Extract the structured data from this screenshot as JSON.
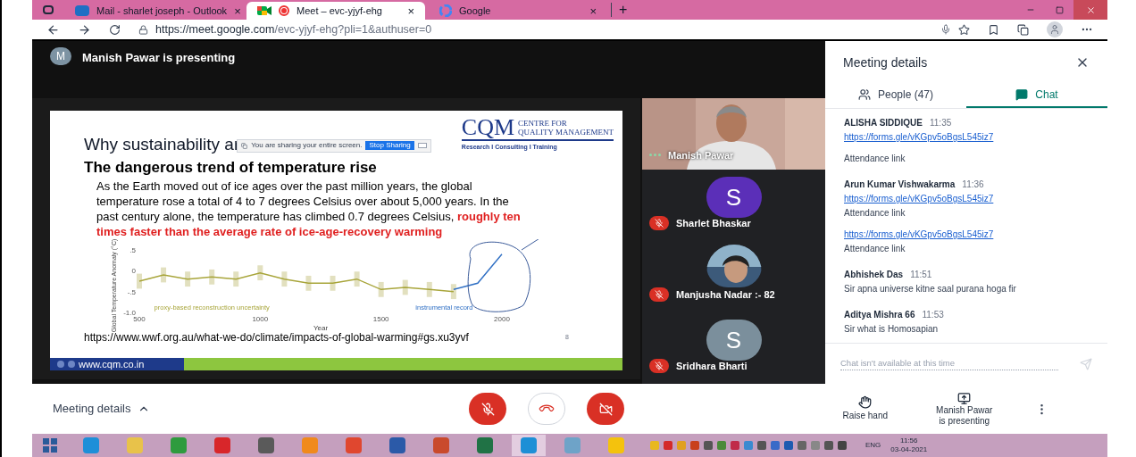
{
  "browser": {
    "tabs": [
      {
        "title": "Mail - sharlet joseph - Outlook",
        "kind": "mail",
        "selected": false,
        "recording": false,
        "close": "×"
      },
      {
        "title": "Meet – evc-yjyf-ehg",
        "kind": "meet",
        "selected": true,
        "recording": true,
        "close": "×"
      },
      {
        "title": "Google",
        "kind": "google",
        "selected": false,
        "recording": false,
        "close": "×"
      }
    ],
    "new_tab": "+",
    "url_host": "https://meet.google.com",
    "url_path": "/evc-yjyf-ehg?pli=1&authuser=0"
  },
  "presenter": {
    "initial": "M",
    "label": "Manish Pawar is presenting"
  },
  "slide": {
    "title": "Why sustainability ar",
    "sharing_notice": "You are sharing your entire screen.",
    "stop_button": "Stop Sharing",
    "logo": "CQM",
    "logo_line1": "CENTRE FOR",
    "logo_line2": "QUALITY MANAGEMENT",
    "logo_tagline": "Research I Consulting I Training",
    "heading": "The dangerous trend of temperature rise",
    "body": "As the Earth moved out of ice ages over the past million years, the global temperature rose a total of 4 to 7 degrees Celsius over about 5,000 years. In the past century alone, the temperature has climbed 0.7 degrees Celsius,",
    "highlight": "roughly ten times faster than the average rate of ice-age-recovery warming",
    "chart_data": {
      "type": "line",
      "xlabel": "Year",
      "ylabel": "Global Temperature Anomaly (°C)",
      "x": [
        500,
        600,
        700,
        800,
        900,
        1000,
        1100,
        1200,
        1300,
        1400,
        1500,
        1600,
        1700,
        1800,
        1900,
        2000
      ],
      "series": [
        {
          "name": "proxy-based reconstruction uncertainty",
          "color": "#a8a53a",
          "values": [
            -0.25,
            -0.1,
            -0.2,
            -0.15,
            -0.2,
            -0.05,
            -0.2,
            -0.3,
            -0.3,
            -0.2,
            -0.45,
            -0.4,
            -0.45,
            -0.5,
            null,
            null
          ],
          "errors": [
            0.18,
            0.18,
            0.18,
            0.18,
            0.18,
            0.18,
            0.18,
            0.18,
            0.18,
            0.18,
            0.18,
            0.18,
            0.18,
            0.18,
            null,
            null
          ]
        },
        {
          "name": "instrumental record",
          "color": "#2f6fc4",
          "values": [
            null,
            null,
            null,
            null,
            null,
            null,
            null,
            null,
            null,
            null,
            null,
            null,
            null,
            -0.45,
            -0.3,
            0.4
          ]
        }
      ],
      "xlim": [
        500,
        2000
      ],
      "ylim": [
        -1,
        0.5
      ],
      "xticks": [
        {
          "value": 500,
          "label": "500"
        },
        {
          "value": 1000,
          "label": "1000"
        },
        {
          "value": 1500,
          "label": "1500"
        },
        {
          "value": 2000,
          "label": "2000"
        }
      ],
      "yticks": [
        {
          "value": 0.5,
          "label": ".5"
        },
        {
          "value": 0,
          "label": "0"
        },
        {
          "value": -0.5,
          "label": "-.5"
        },
        {
          "value": -1,
          "label": "-1.0"
        }
      ]
    },
    "source": "https://www.wwf.org.au/what-we-do/climate/impacts-of-global-warming#gs.xu3yvf",
    "page": "8",
    "footer": "www.cqm.co.in"
  },
  "tiles": [
    {
      "kind": "video",
      "name": "Manish Pawar",
      "muted": false
    },
    {
      "kind": "letter",
      "name": "Sharlet Bhaskar",
      "initial": "S",
      "color": "#5b2fb8",
      "muted": true
    },
    {
      "name": "Manjusha Nadar :- 82",
      "muted": true
    },
    {
      "kind": "letter",
      "name": "Sridhara Bharti",
      "initial": "S",
      "color": "#7b8f9c",
      "muted": true
    }
  ],
  "panel": {
    "title": "Meeting details",
    "tabs": [
      {
        "label": "People (47)",
        "kind": "people",
        "selected": false
      },
      {
        "label": "Chat",
        "kind": "chat",
        "selected": true
      }
    ],
    "messages": [
      {
        "sender": "ALISHA SIDDIQUE",
        "time": "11:35",
        "items": [
          {
            "kind": "link",
            "text": "https://forms.gle/vKGpv5oBgsL545iz7"
          },
          {
            "kind": "text",
            "text": "Attendance link"
          }
        ]
      },
      {
        "sender": "Arun Kumar Vishwakarma",
        "time": "11:36",
        "items": [
          {
            "kind": "link",
            "text": "https://forms.gle/vKGpv5oBgsL545iz7"
          },
          {
            "kind": "text",
            "text": "Attendance link"
          },
          {
            "kind": "link",
            "text": "https://forms.gle/vKGpv5oBgsL545iz7"
          },
          {
            "kind": "text",
            "text": "Attendance link"
          }
        ]
      },
      {
        "sender": "Abhishek Das",
        "time": "11:51",
        "items": [
          {
            "kind": "text",
            "text": "Sir apna universe kitne saal purana hoga fir"
          }
        ]
      },
      {
        "sender": "Aditya Mishra 66",
        "time": "11:53",
        "items": [
          {
            "kind": "text",
            "text": "Sir what is Homosapian"
          }
        ]
      }
    ],
    "chat_placeholder": "Chat isn't available at this time",
    "chat_enabled": false
  },
  "bottom": {
    "details": "Meeting details",
    "mic_on": false,
    "camera_on": false,
    "raise_hand": "Raise hand",
    "presenting": [
      "Manish Pawar",
      "is presenting"
    ]
  },
  "taskbar": {
    "apps": [
      {
        "color": "#1e8fd8",
        "selected": false
      },
      {
        "color": "#e8c24a",
        "selected": false
      },
      {
        "color": "#2e9b3e",
        "selected": false
      },
      {
        "color": "#d8262a",
        "selected": false
      },
      {
        "color": "#5a5a5a",
        "selected": false
      },
      {
        "color": "#f08a1c",
        "selected": false
      },
      {
        "color": "#e0472f",
        "selected": false
      },
      {
        "color": "#2b5aa8",
        "selected": false
      },
      {
        "color": "#c94a2c",
        "selected": false
      },
      {
        "color": "#207245",
        "selected": false
      },
      {
        "color": "#1d8fd6",
        "selected": true
      },
      {
        "color": "#6ea3c8",
        "selected": false
      },
      {
        "color": "#f4c20d",
        "selected": false
      }
    ],
    "language": "ENG",
    "time": "11:56",
    "date": "03-04-2021"
  }
}
